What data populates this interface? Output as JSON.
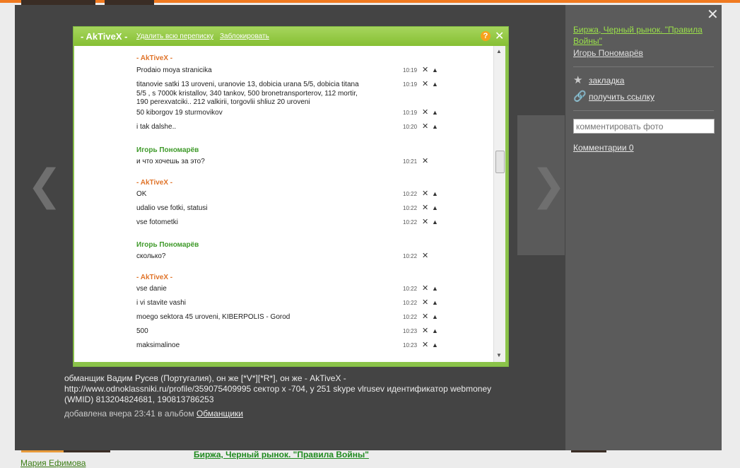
{
  "background": {
    "album_link": "Биржа, Черный рынок. \"Правила Войны\"",
    "user_name": "Мария Ефимова"
  },
  "nav": {
    "prev_glyph": "❮",
    "next_glyph": "❯"
  },
  "screenshot": {
    "title": "- AkTiveX -",
    "delete_link": "Удалить всю переписку",
    "block_link": "Заблокировать",
    "help_glyph": "?",
    "close_glyph": "✕",
    "messages": [
      {
        "sender": "- AkTiveX -",
        "text": "",
        "time": ""
      },
      {
        "sender": "",
        "text": "Prodaio moya stranicika",
        "time": "10:19",
        "warn": true
      },
      {
        "sender": "",
        "text": "titanovie satki 13 uroveni, uranovie 13, dobicia urana 5/5, dobicia titana 5/5 , s 7000k kristallov, 340 tankov, 500 bronetransporterov, 112 mortir, 190 perexvatciki.. 212 valkirii, torgovlii shliuz 20 uroveni",
        "time": "10:19",
        "warn": true
      },
      {
        "sender": "",
        "text": "50 kiborgov 19 sturmovikov",
        "time": "10:19",
        "warn": true
      },
      {
        "sender": "",
        "text": "i tak dalshe..",
        "time": "10:20",
        "warn": true
      },
      {
        "sender": "Игорь Пономарёв",
        "text": "",
        "time": ""
      },
      {
        "sender": "",
        "text": "и что хочешь за это?",
        "time": "10:21",
        "warn": false
      },
      {
        "sender": "- AkTiveX -",
        "text": "",
        "time": ""
      },
      {
        "sender": "",
        "text": "OK",
        "time": "10:22",
        "warn": true
      },
      {
        "sender": "",
        "text": "udalio vse fotki, statusi",
        "time": "10:22",
        "warn": true
      },
      {
        "sender": "",
        "text": "vse fotometki",
        "time": "10:22",
        "warn": true
      },
      {
        "sender": "Игорь Пономарёв",
        "text": "",
        "time": ""
      },
      {
        "sender": "",
        "text": "сколько?",
        "time": "10:22",
        "warn": false
      },
      {
        "sender": "- AkTiveX -",
        "text": "",
        "time": ""
      },
      {
        "sender": "",
        "text": "vse danie",
        "time": "10:22",
        "warn": true
      },
      {
        "sender": "",
        "text": "i vi stavite vashi",
        "time": "10:22",
        "warn": true
      },
      {
        "sender": "",
        "text": "moego sektora 45 uroveni, KIBERPOLIS - Gorod",
        "time": "10:22",
        "warn": true
      },
      {
        "sender": "",
        "text": "500",
        "time": "10:23",
        "warn": true
      },
      {
        "sender": "",
        "text": "maksimalinoe",
        "time": "10:23",
        "warn": true
      }
    ]
  },
  "caption": {
    "text": "обманщик Вадим Русев (Португалия), он же [*V*][*R*], он же - AkTiveX - http://www.odnoklassniki.ru/profile/359075409995 сектор x -704, y 251 skype vlrusev идентификатор webmoney (WMID) 813204824681, 190813786253",
    "added_prefix": "добавлена вчера 23:41 в альбом",
    "album_name": "Обманщики"
  },
  "sidebar": {
    "close_glyph": "✕",
    "album_title": "Биржа, Черный рынок. \"Правила Войны\"",
    "author": "Игорь Пономарёв",
    "bookmark_label": "закладка",
    "get_link_label": "получить ссылку",
    "comment_placeholder": "комментировать фото",
    "comments_label": "Комментарии 0"
  },
  "colors": {
    "orange_sender": "#e0742a",
    "green_sender": "#3f9a2a",
    "accent_green": "#8bc34a"
  }
}
